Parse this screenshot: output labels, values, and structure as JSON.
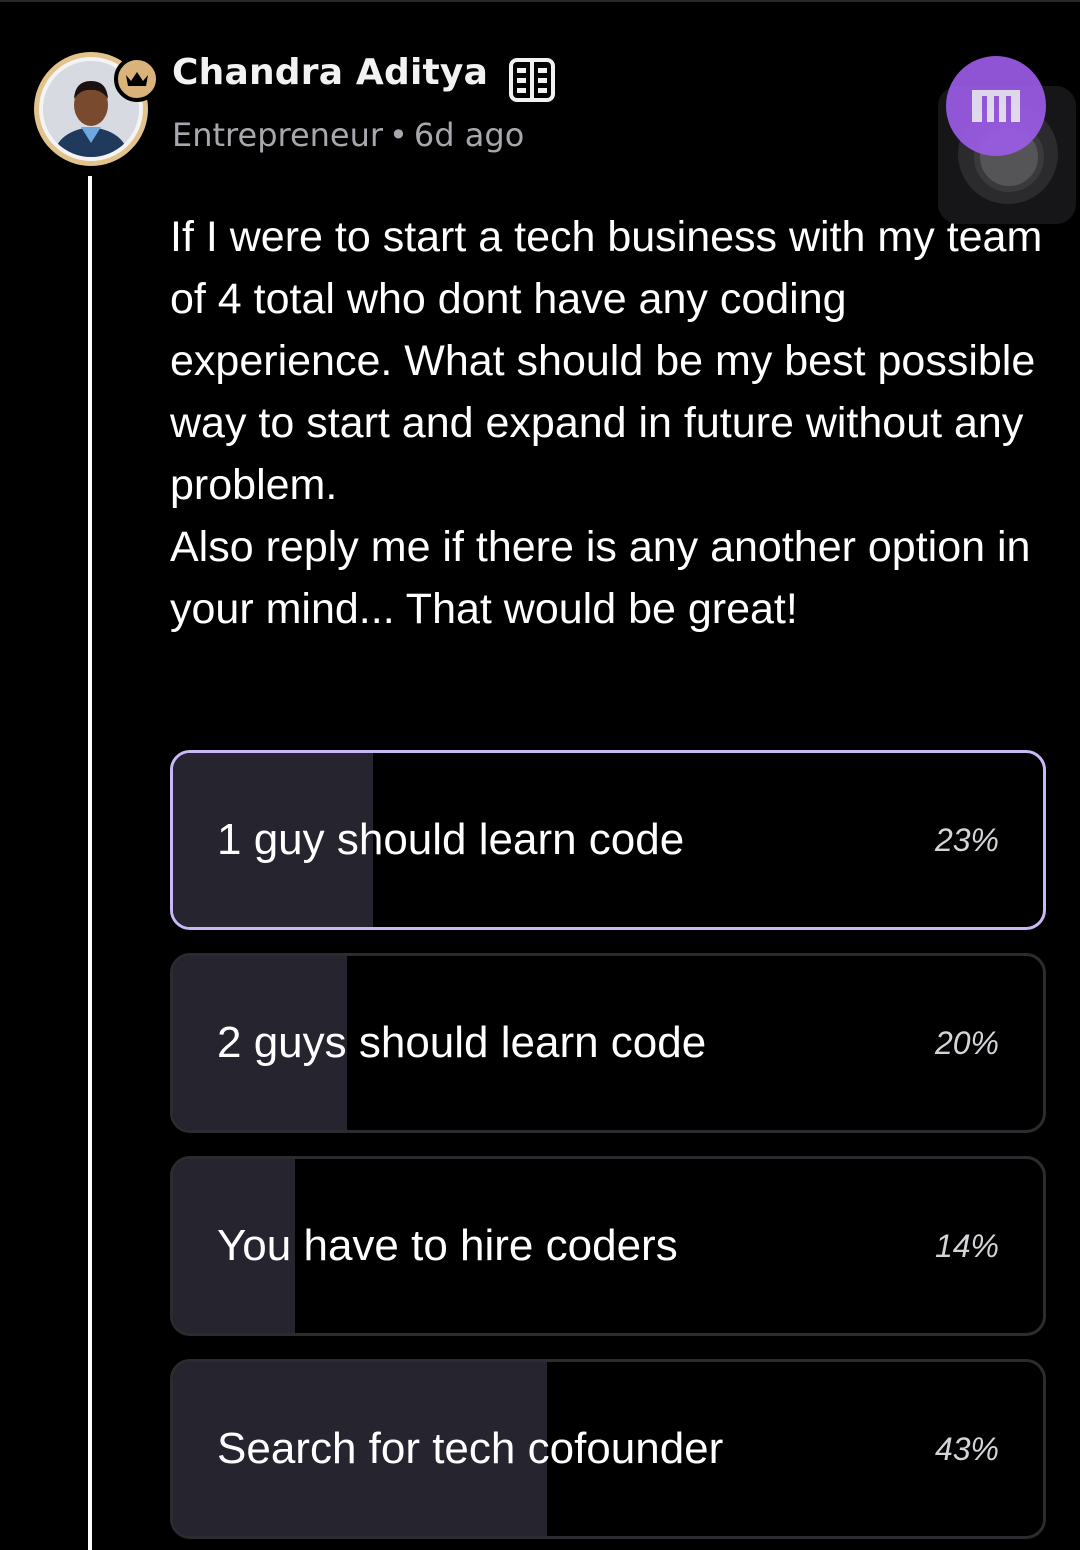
{
  "post": {
    "author": {
      "name": "Chandra Aditya",
      "role": "Entrepreneur",
      "separator": "•",
      "time_ago": "6d ago",
      "badge_icon": "crown-icon",
      "verified_icon": "building-icon"
    },
    "body": "If I were to start a tech business with my team of 4 total who dont have any coding experience. What should be my best possible way to start and expand in future without any problem.\nAlso reply me if there is any another option in your mind... That would be great!",
    "poll": {
      "options": [
        {
          "label": "1 guy should learn code",
          "percent_label": "23%",
          "percent": 23,
          "selected": true
        },
        {
          "label": "2 guys should learn code",
          "percent_label": "20%",
          "percent": 20,
          "selected": false
        },
        {
          "label": "You have to hire coders",
          "percent_label": "14%",
          "percent": 14,
          "selected": false
        },
        {
          "label": "Search for tech cofounder",
          "percent_label": "43%",
          "percent": 43,
          "selected": false
        }
      ]
    }
  },
  "colors": {
    "background": "#000000",
    "avatar_ring": "#e3c38c",
    "selected_border": "#c9b8f5",
    "poll_fill": "#26242f",
    "brand_purple": "#9b5ce6",
    "meta_text": "#a7a7ad"
  }
}
